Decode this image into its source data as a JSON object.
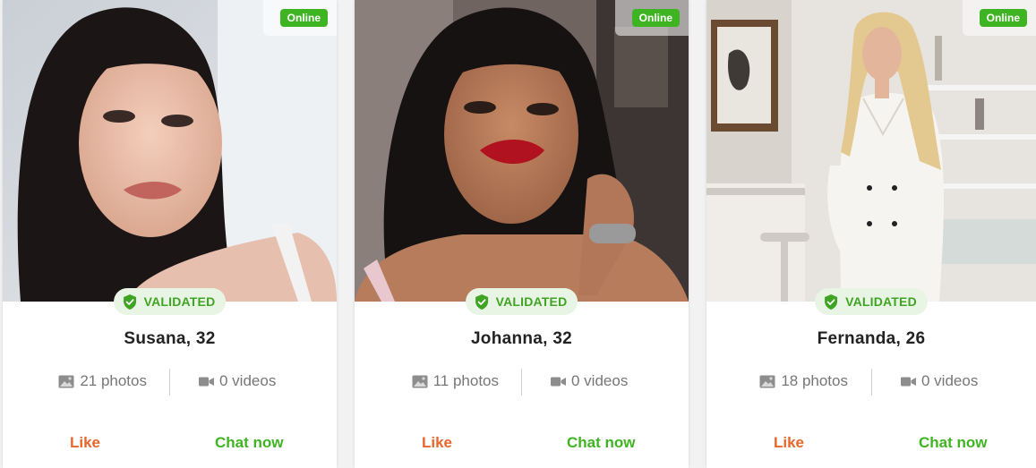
{
  "colors": {
    "online_bg": "#3fb423",
    "validated_text": "#3fa423",
    "validated_bg": "#e9f5e4",
    "like": "#e8652b",
    "chat": "#3fb423"
  },
  "icons": {
    "validated": "shield-check-icon",
    "photos": "image-icon",
    "videos": "video-camera-icon"
  },
  "profiles": [
    {
      "status": "Online",
      "badge": "VALIDATED",
      "name_age": "Susana, 32",
      "photos": "21 photos",
      "videos": "0 videos",
      "like_label": "Like",
      "chat_label": "Chat now"
    },
    {
      "status": "Online",
      "badge": "VALIDATED",
      "name_age": "Johanna, 32",
      "photos": "11 photos",
      "videos": "0 videos",
      "like_label": "Like",
      "chat_label": "Chat now"
    },
    {
      "status": "Online",
      "badge": "VALIDATED",
      "name_age": "Fernanda, 26",
      "photos": "18 photos",
      "videos": "0 videos",
      "like_label": "Like",
      "chat_label": "Chat now"
    }
  ]
}
